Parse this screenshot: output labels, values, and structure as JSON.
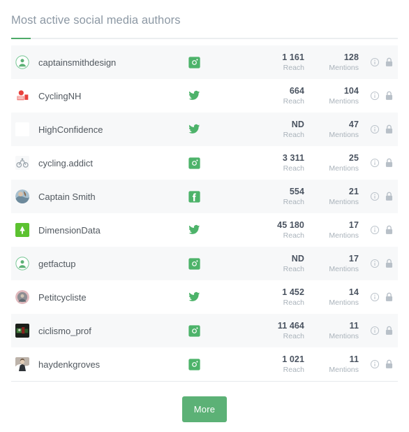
{
  "widget": {
    "title": "Most active social media authors",
    "accent_color": "#4eaa68",
    "button_color": "#5cb176",
    "value_color": "#4a5360",
    "label_color": "#aab3bb",
    "name_color": "#51585f",
    "stripe_color": "#f7f8f9"
  },
  "columns": {
    "reach_label": "Reach",
    "mentions_label": "Mentions"
  },
  "icons": {
    "info": "info-circle-icon",
    "lock": "lock-icon",
    "twitter": "twitter-icon",
    "instagram": "instagram-icon",
    "facebook": "facebook-icon"
  },
  "footer": {
    "more_label": "More"
  },
  "authors": [
    {
      "name": "captainsmithdesign",
      "network": "instagram",
      "reach": "1 161",
      "reach_label": "Reach",
      "mentions": "128",
      "mentions_label": "Mentions",
      "avatar": "green-ring-person",
      "striped": true
    },
    {
      "name": "CyclingNH",
      "network": "twitter",
      "reach": "664",
      "reach_label": "Reach",
      "mentions": "104",
      "mentions_label": "Mentions",
      "avatar": "red-logo",
      "striped": false
    },
    {
      "name": "HighConfidence",
      "network": "twitter",
      "reach": "ND",
      "reach_label": "Reach",
      "mentions": "47",
      "mentions_label": "Mentions",
      "avatar": "blank",
      "striped": true
    },
    {
      "name": "cycling.addict",
      "network": "instagram",
      "reach": "3 311",
      "reach_label": "Reach",
      "mentions": "25",
      "mentions_label": "Mentions",
      "avatar": "gray-bike",
      "striped": false
    },
    {
      "name": "Captain Smith",
      "network": "facebook",
      "reach": "554",
      "reach_label": "Reach",
      "mentions": "21",
      "mentions_label": "Mentions",
      "avatar": "photo-portrait",
      "striped": true
    },
    {
      "name": "DimensionData",
      "network": "twitter",
      "reach": "45 180",
      "reach_label": "Reach",
      "mentions": "17",
      "mentions_label": "Mentions",
      "avatar": "green-square-logo",
      "striped": false
    },
    {
      "name": "getfactup",
      "network": "instagram",
      "reach": "ND",
      "reach_label": "Reach",
      "mentions": "17",
      "mentions_label": "Mentions",
      "avatar": "green-ring-person",
      "striped": true
    },
    {
      "name": "Petitcycliste",
      "network": "twitter",
      "reach": "1 452",
      "reach_label": "Reach",
      "mentions": "14",
      "mentions_label": "Mentions",
      "avatar": "pink-ring-photo",
      "striped": false
    },
    {
      "name": "ciclismo_prof",
      "network": "instagram",
      "reach": "11 464",
      "reach_label": "Reach",
      "mentions": "11",
      "mentions_label": "Mentions",
      "avatar": "dark-photo",
      "striped": true
    },
    {
      "name": "haydenkgroves",
      "network": "instagram",
      "reach": "1 021",
      "reach_label": "Reach",
      "mentions": "11",
      "mentions_label": "Mentions",
      "avatar": "light-photo",
      "striped": false
    }
  ]
}
